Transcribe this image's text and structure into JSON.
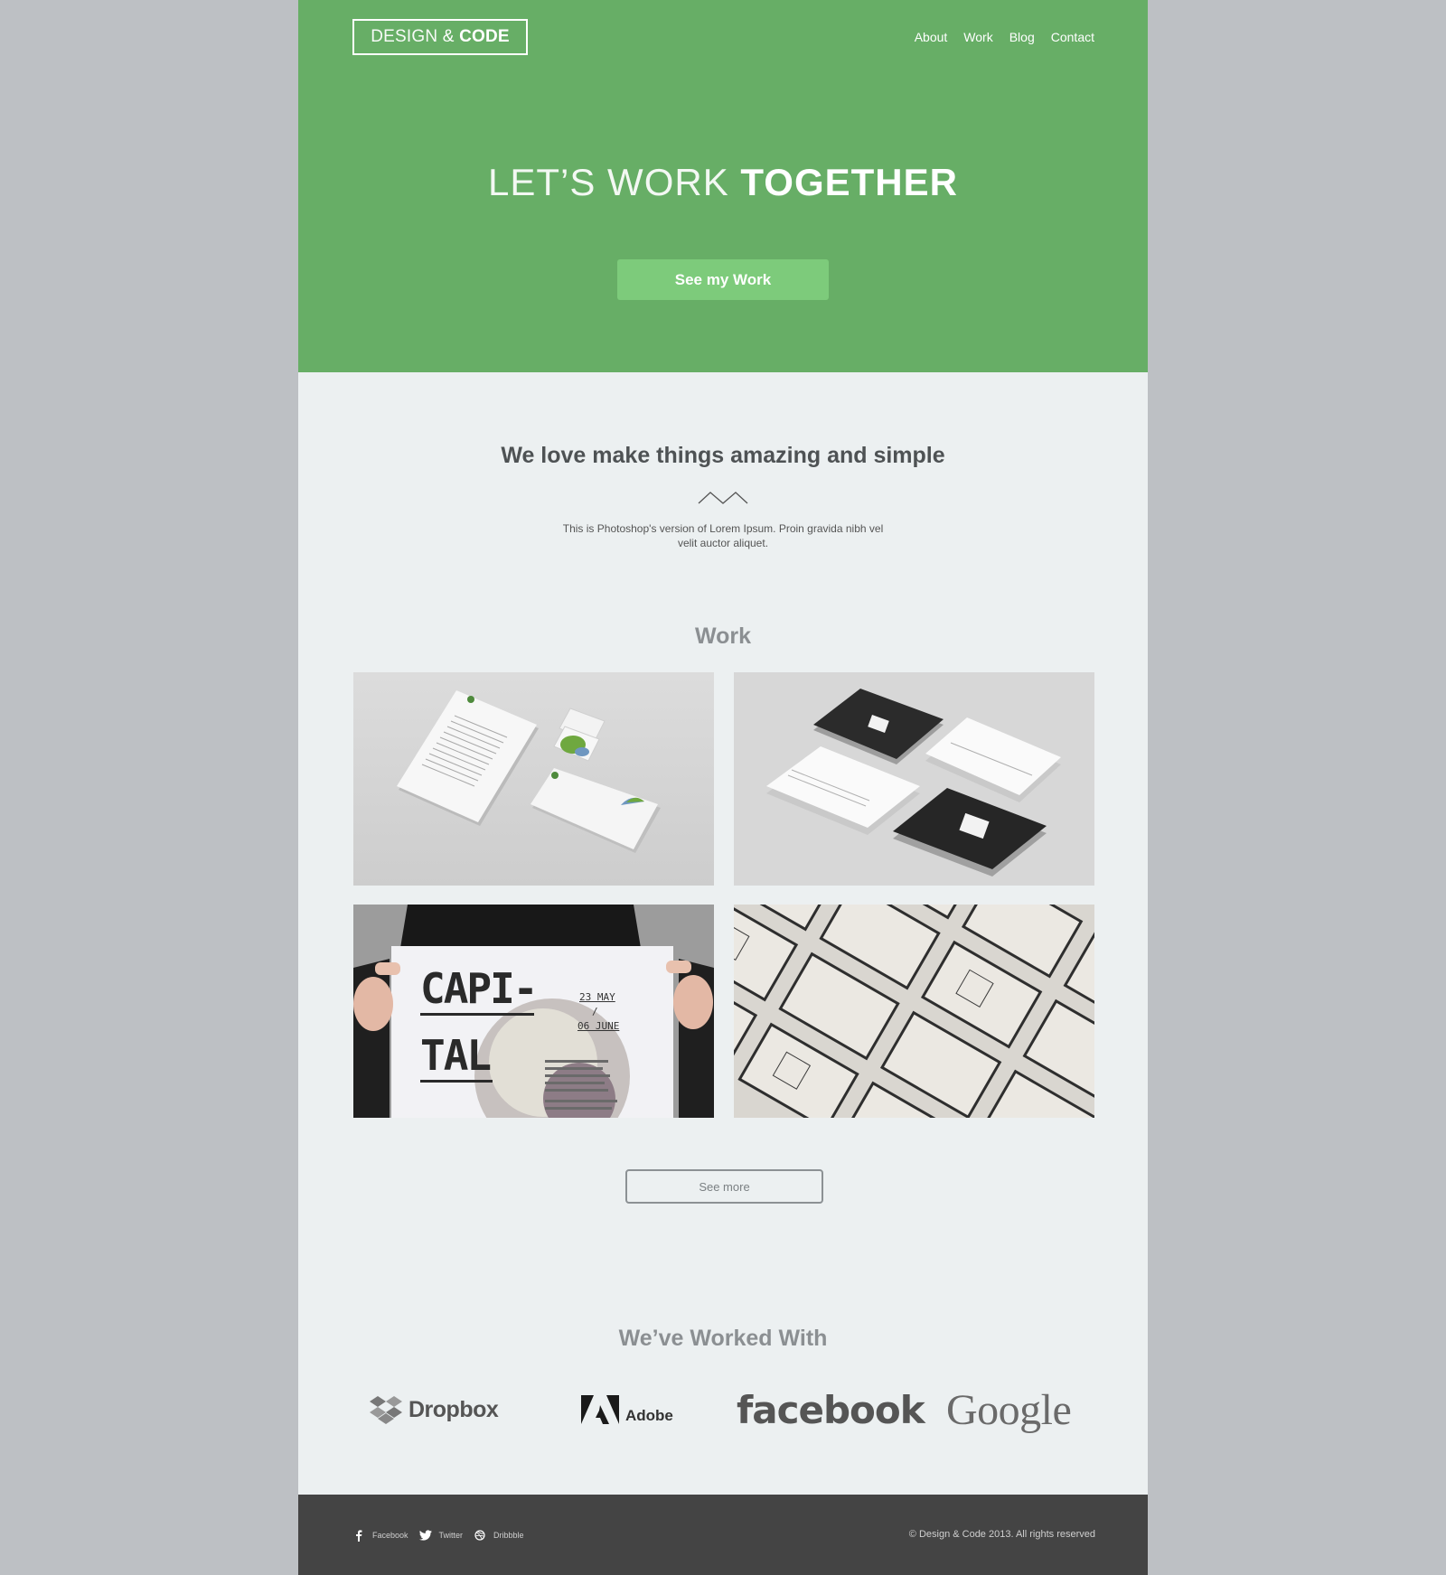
{
  "brand": {
    "logo_light": "DESIGN",
    "logo_amp": "&",
    "logo_bold": "CODE",
    "accent": "#67ae66",
    "button": "#7dcb7b"
  },
  "nav": {
    "items": [
      {
        "label": "About"
      },
      {
        "label": "Work"
      },
      {
        "label": "Blog"
      },
      {
        "label": "Contact"
      }
    ]
  },
  "hero": {
    "title_light": "LET’S WORK",
    "title_bold": "TOGETHER",
    "cta_label": "See my Work"
  },
  "intro": {
    "title": "We love make things amazing and simple",
    "text": "This is Photoshop's version  of Lorem Ipsum. Proin gravida nibh vel velit auctor aliquet."
  },
  "work": {
    "title": "Work",
    "poster": {
      "headline_1": "CAPI-",
      "headline_2": "TAL",
      "date_1": "23 MAY",
      "date_sep": "/",
      "date_2": "06 JUNE"
    },
    "see_more_label": "See more"
  },
  "clients": {
    "title": "We’ve Worked With",
    "items": [
      {
        "name": "Dropbox",
        "icon": "dropbox-icon"
      },
      {
        "name": "Adobe",
        "icon": "adobe-icon"
      },
      {
        "name": "facebook",
        "icon": ""
      },
      {
        "name": "Google",
        "icon": ""
      }
    ]
  },
  "footer": {
    "social": [
      {
        "label": "Facebook",
        "icon": "facebook-icon"
      },
      {
        "label": "Twitter",
        "icon": "twitter-icon"
      },
      {
        "label": "Dribbble",
        "icon": "dribbble-icon"
      }
    ],
    "copyright": "© Design & Code 2013. All rights reserved"
  }
}
